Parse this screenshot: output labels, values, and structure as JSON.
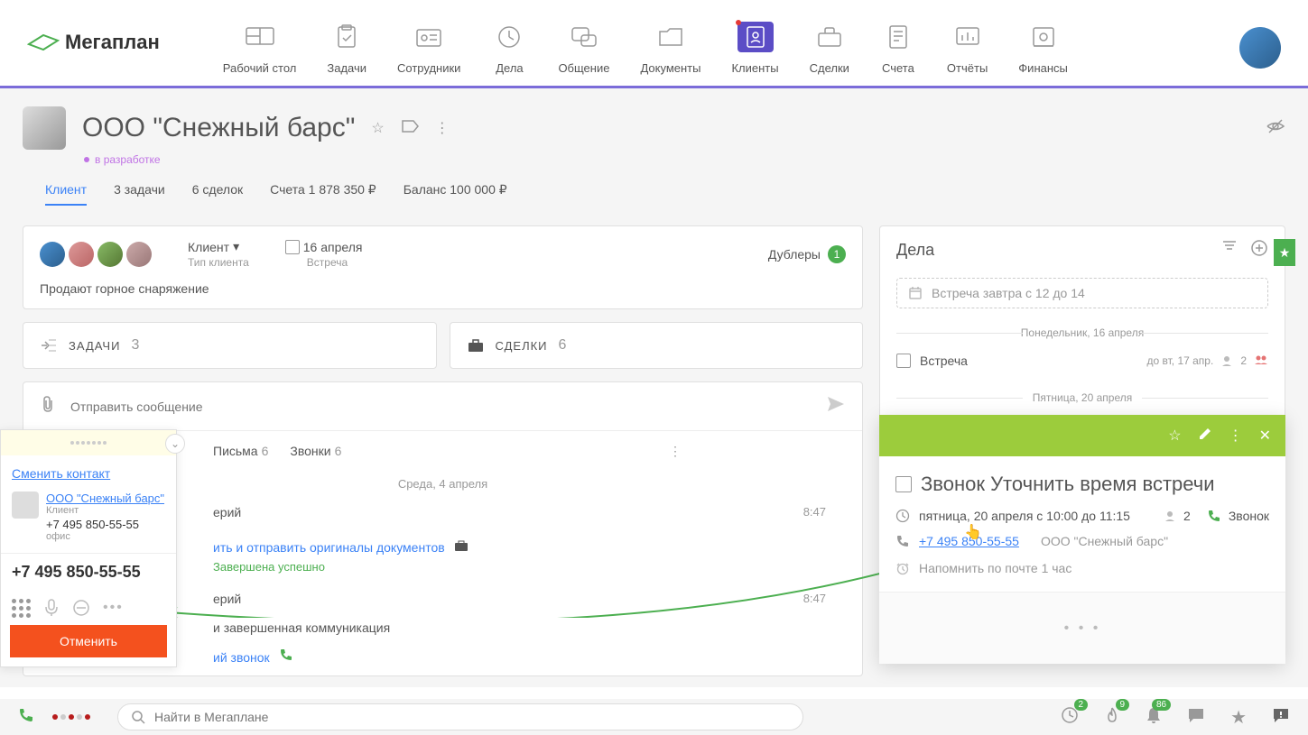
{
  "nav": {
    "logo": "Мегаплан",
    "items": [
      "Рабочий стол",
      "Задачи",
      "Сотрудники",
      "Дела",
      "Общение",
      "Документы",
      "Клиенты",
      "Сделки",
      "Счета",
      "Отчёты",
      "Финансы"
    ]
  },
  "client": {
    "title": "ООО \"Снежный барс\"",
    "status": "в разработке",
    "tabs": {
      "client": "Клиент",
      "tasks": "3 задачи",
      "deals": "6 сделок",
      "bills": "Счета 1 878 350 ₽",
      "balance": "Баланс 100 000 ₽"
    },
    "info": {
      "type_label": "Клиент",
      "type_sub": "Тип клиента",
      "date": "16 апреля",
      "date_sub": "Встреча",
      "dublers": "Дублеры",
      "dublers_count": "1",
      "desc": "Продают горное снаряжение"
    },
    "cards": {
      "tasks_label": "ЗАДАЧИ",
      "tasks_count": "3",
      "deals_label": "СДЕЛКИ",
      "deals_count": "6"
    }
  },
  "messages": {
    "placeholder": "Отправить сообщение",
    "tabs": {
      "letters": "Письма",
      "letters_cnt": "6",
      "calls": "Звонки",
      "calls_cnt": "6"
    },
    "date": "Среда, 4 апреля",
    "items": [
      {
        "name_suffix": "ерий",
        "time": "8:47",
        "link": "ить и отправить оригиналы документов",
        "status": "Завершена успешно"
      },
      {
        "name_suffix": "ерий",
        "time": "8:47",
        "sub": "и завершенная коммуникация",
        "call": "ий звонок"
      }
    ]
  },
  "dela": {
    "title": "Дела",
    "input_placeholder": "Встреча завтра с 12 до 14",
    "sep1": "Понедельник, 16 апреля",
    "item1": {
      "title": "Встреча",
      "meta": "до вт, 17 апр.",
      "people": "2"
    },
    "sep2": "Пятница, 20 апреля"
  },
  "call_panel": {
    "title": "Звонок Уточнить время встречи",
    "datetime": "пятница, 20 апреля с 10:00 до 11:15",
    "people": "2",
    "type": "Звонок",
    "phone": "+7 495 850-55-55",
    "company": "ООО \"Снежный барс\"",
    "remind": "Напомнить по почте 1 час"
  },
  "phone_popup": {
    "change": "Сменить контакт",
    "company": "ООО \"Снежный барс\"",
    "type": "Клиент",
    "phone": "+7 495 850-55-55",
    "office": "офис",
    "display": "+7 495 850-55-55",
    "cancel": "Отменить"
  },
  "bottom": {
    "search_placeholder": "Найти в Мегаплане",
    "badges": {
      "clock": "2",
      "fire": "9",
      "bell": "86"
    }
  }
}
